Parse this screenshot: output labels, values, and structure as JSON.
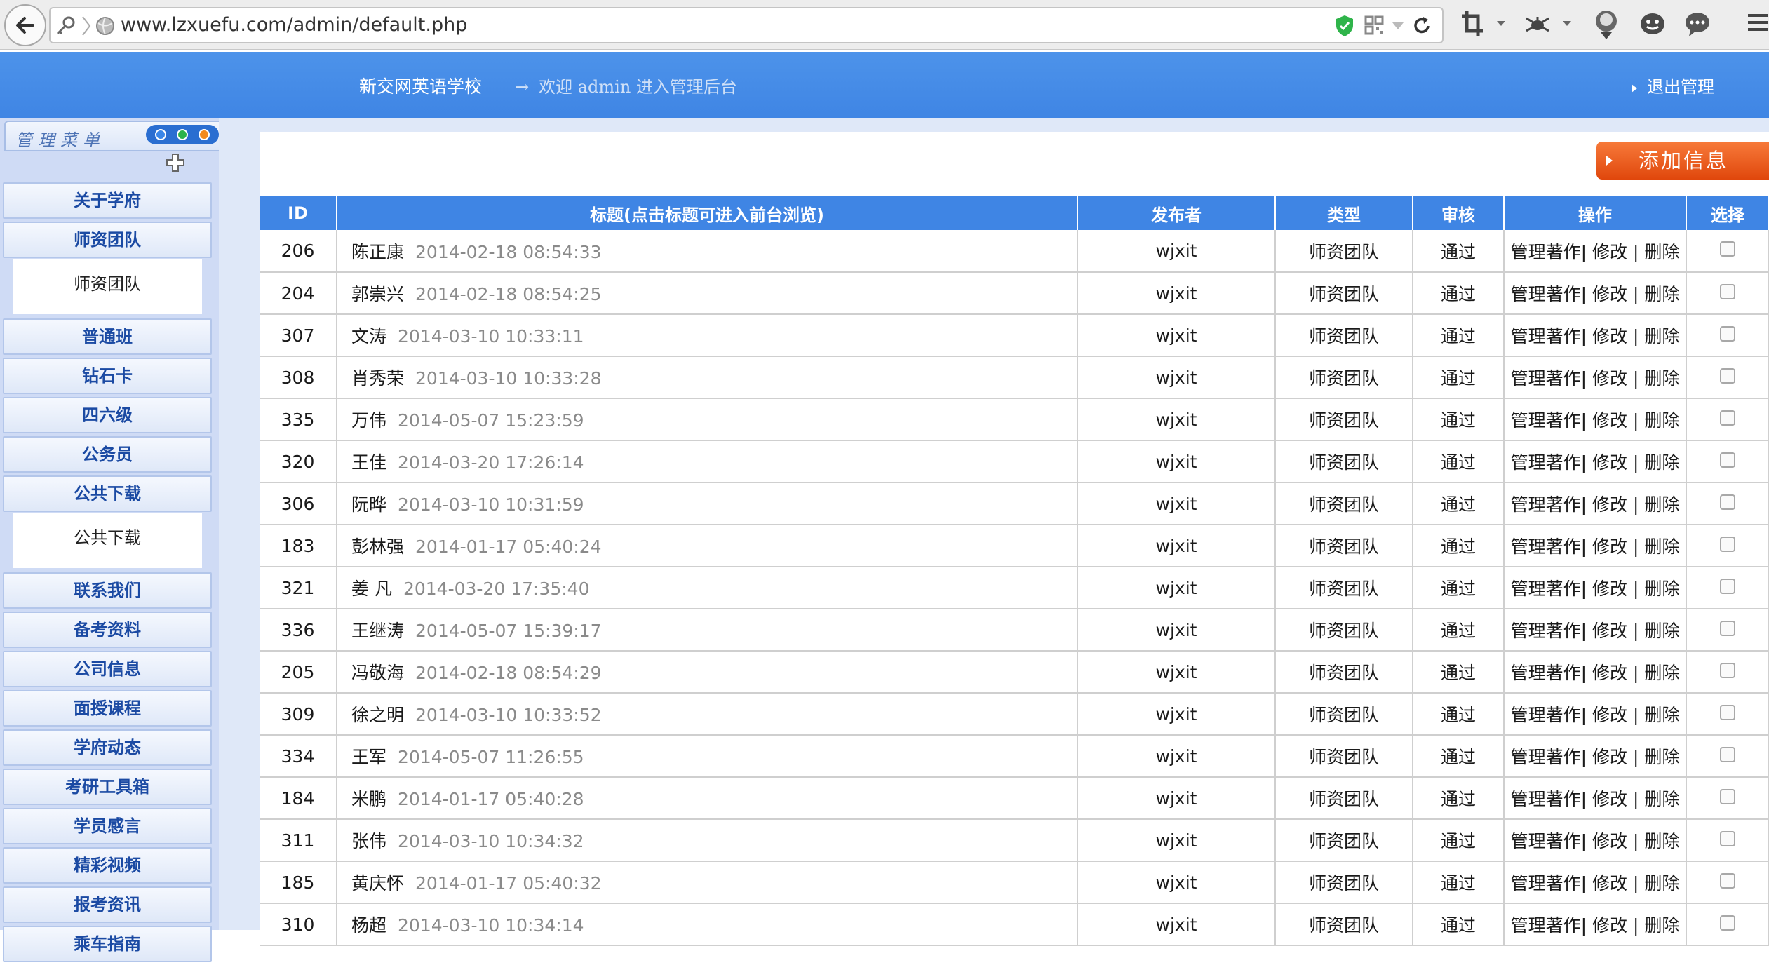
{
  "browser": {
    "url": "www.lzxuefu.com/admin/default.php"
  },
  "header": {
    "school_name": "新交网英语学校",
    "welcome_arrow": "→",
    "welcome_text": "欢迎 admin 进入管理后台",
    "logout_label": "退出管理"
  },
  "sidebar": {
    "title": "管理菜单",
    "dot_colors": [
      "#2a6ed1",
      "#2bb34a",
      "#f28a1e"
    ],
    "items": [
      {
        "label": "关于学府"
      },
      {
        "label": "师资团队",
        "sub": "师资团队"
      },
      {
        "label": "普通班"
      },
      {
        "label": "钻石卡"
      },
      {
        "label": "四六级"
      },
      {
        "label": "公务员"
      },
      {
        "label": "公共下载",
        "sub": "公共下载"
      },
      {
        "label": "联系我们"
      },
      {
        "label": "备考资料"
      },
      {
        "label": "公司信息"
      },
      {
        "label": "面授课程"
      },
      {
        "label": "学府动态"
      },
      {
        "label": "考研工具箱"
      },
      {
        "label": "学员感言"
      },
      {
        "label": "精彩视频"
      },
      {
        "label": "报考资讯"
      },
      {
        "label": "乘车指南"
      }
    ]
  },
  "main": {
    "add_button_label": "添加信息",
    "columns": [
      "ID",
      "标题(点击标题可进入前台浏览)",
      "发布者",
      "类型",
      "审核",
      "操作",
      "选择"
    ],
    "op_labels": {
      "manage": "管理著作",
      "edit": "修改",
      "delete": "删除",
      "sep": "|"
    },
    "rows": [
      {
        "id": "206",
        "name": "陈正康",
        "date": "2014-02-18 08:54:33",
        "publisher": "wjxit",
        "type": "师资团队",
        "status": "通过"
      },
      {
        "id": "204",
        "name": "郭崇兴",
        "date": "2014-02-18 08:54:25",
        "publisher": "wjxit",
        "type": "师资团队",
        "status": "通过"
      },
      {
        "id": "307",
        "name": "文涛",
        "date": "2014-03-10 10:33:11",
        "publisher": "wjxit",
        "type": "师资团队",
        "status": "通过"
      },
      {
        "id": "308",
        "name": "肖秀荣",
        "date": "2014-03-10 10:33:28",
        "publisher": "wjxit",
        "type": "师资团队",
        "status": "通过"
      },
      {
        "id": "335",
        "name": "万伟",
        "date": "2014-05-07 15:23:59",
        "publisher": "wjxit",
        "type": "师资团队",
        "status": "通过"
      },
      {
        "id": "320",
        "name": "王佳",
        "date": "2014-03-20 17:26:14",
        "publisher": "wjxit",
        "type": "师资团队",
        "status": "通过"
      },
      {
        "id": "306",
        "name": "阮晔",
        "date": "2014-03-10 10:31:59",
        "publisher": "wjxit",
        "type": "师资团队",
        "status": "通过"
      },
      {
        "id": "183",
        "name": "彭林强",
        "date": "2014-01-17 05:40:24",
        "publisher": "wjxit",
        "type": "师资团队",
        "status": "通过"
      },
      {
        "id": "321",
        "name": "姜 凡",
        "date": "2014-03-20 17:35:40",
        "publisher": "wjxit",
        "type": "师资团队",
        "status": "通过"
      },
      {
        "id": "336",
        "name": "王继涛",
        "date": "2014-05-07 15:39:17",
        "publisher": "wjxit",
        "type": "师资团队",
        "status": "通过"
      },
      {
        "id": "205",
        "name": "冯敬海",
        "date": "2014-02-18 08:54:29",
        "publisher": "wjxit",
        "type": "师资团队",
        "status": "通过"
      },
      {
        "id": "309",
        "name": "徐之明",
        "date": "2014-03-10 10:33:52",
        "publisher": "wjxit",
        "type": "师资团队",
        "status": "通过"
      },
      {
        "id": "334",
        "name": "王军",
        "date": "2014-05-07 11:26:55",
        "publisher": "wjxit",
        "type": "师资团队",
        "status": "通过"
      },
      {
        "id": "184",
        "name": "米鹏",
        "date": "2014-01-17 05:40:28",
        "publisher": "wjxit",
        "type": "师资团队",
        "status": "通过"
      },
      {
        "id": "311",
        "name": "张伟",
        "date": "2014-03-10 10:34:32",
        "publisher": "wjxit",
        "type": "师资团队",
        "status": "通过"
      },
      {
        "id": "185",
        "name": "黄庆怀",
        "date": "2014-01-17 05:40:32",
        "publisher": "wjxit",
        "type": "师资团队",
        "status": "通过"
      },
      {
        "id": "310",
        "name": "杨超",
        "date": "2014-03-10 10:34:14",
        "publisher": "wjxit",
        "type": "师资团队",
        "status": "通过"
      }
    ]
  }
}
